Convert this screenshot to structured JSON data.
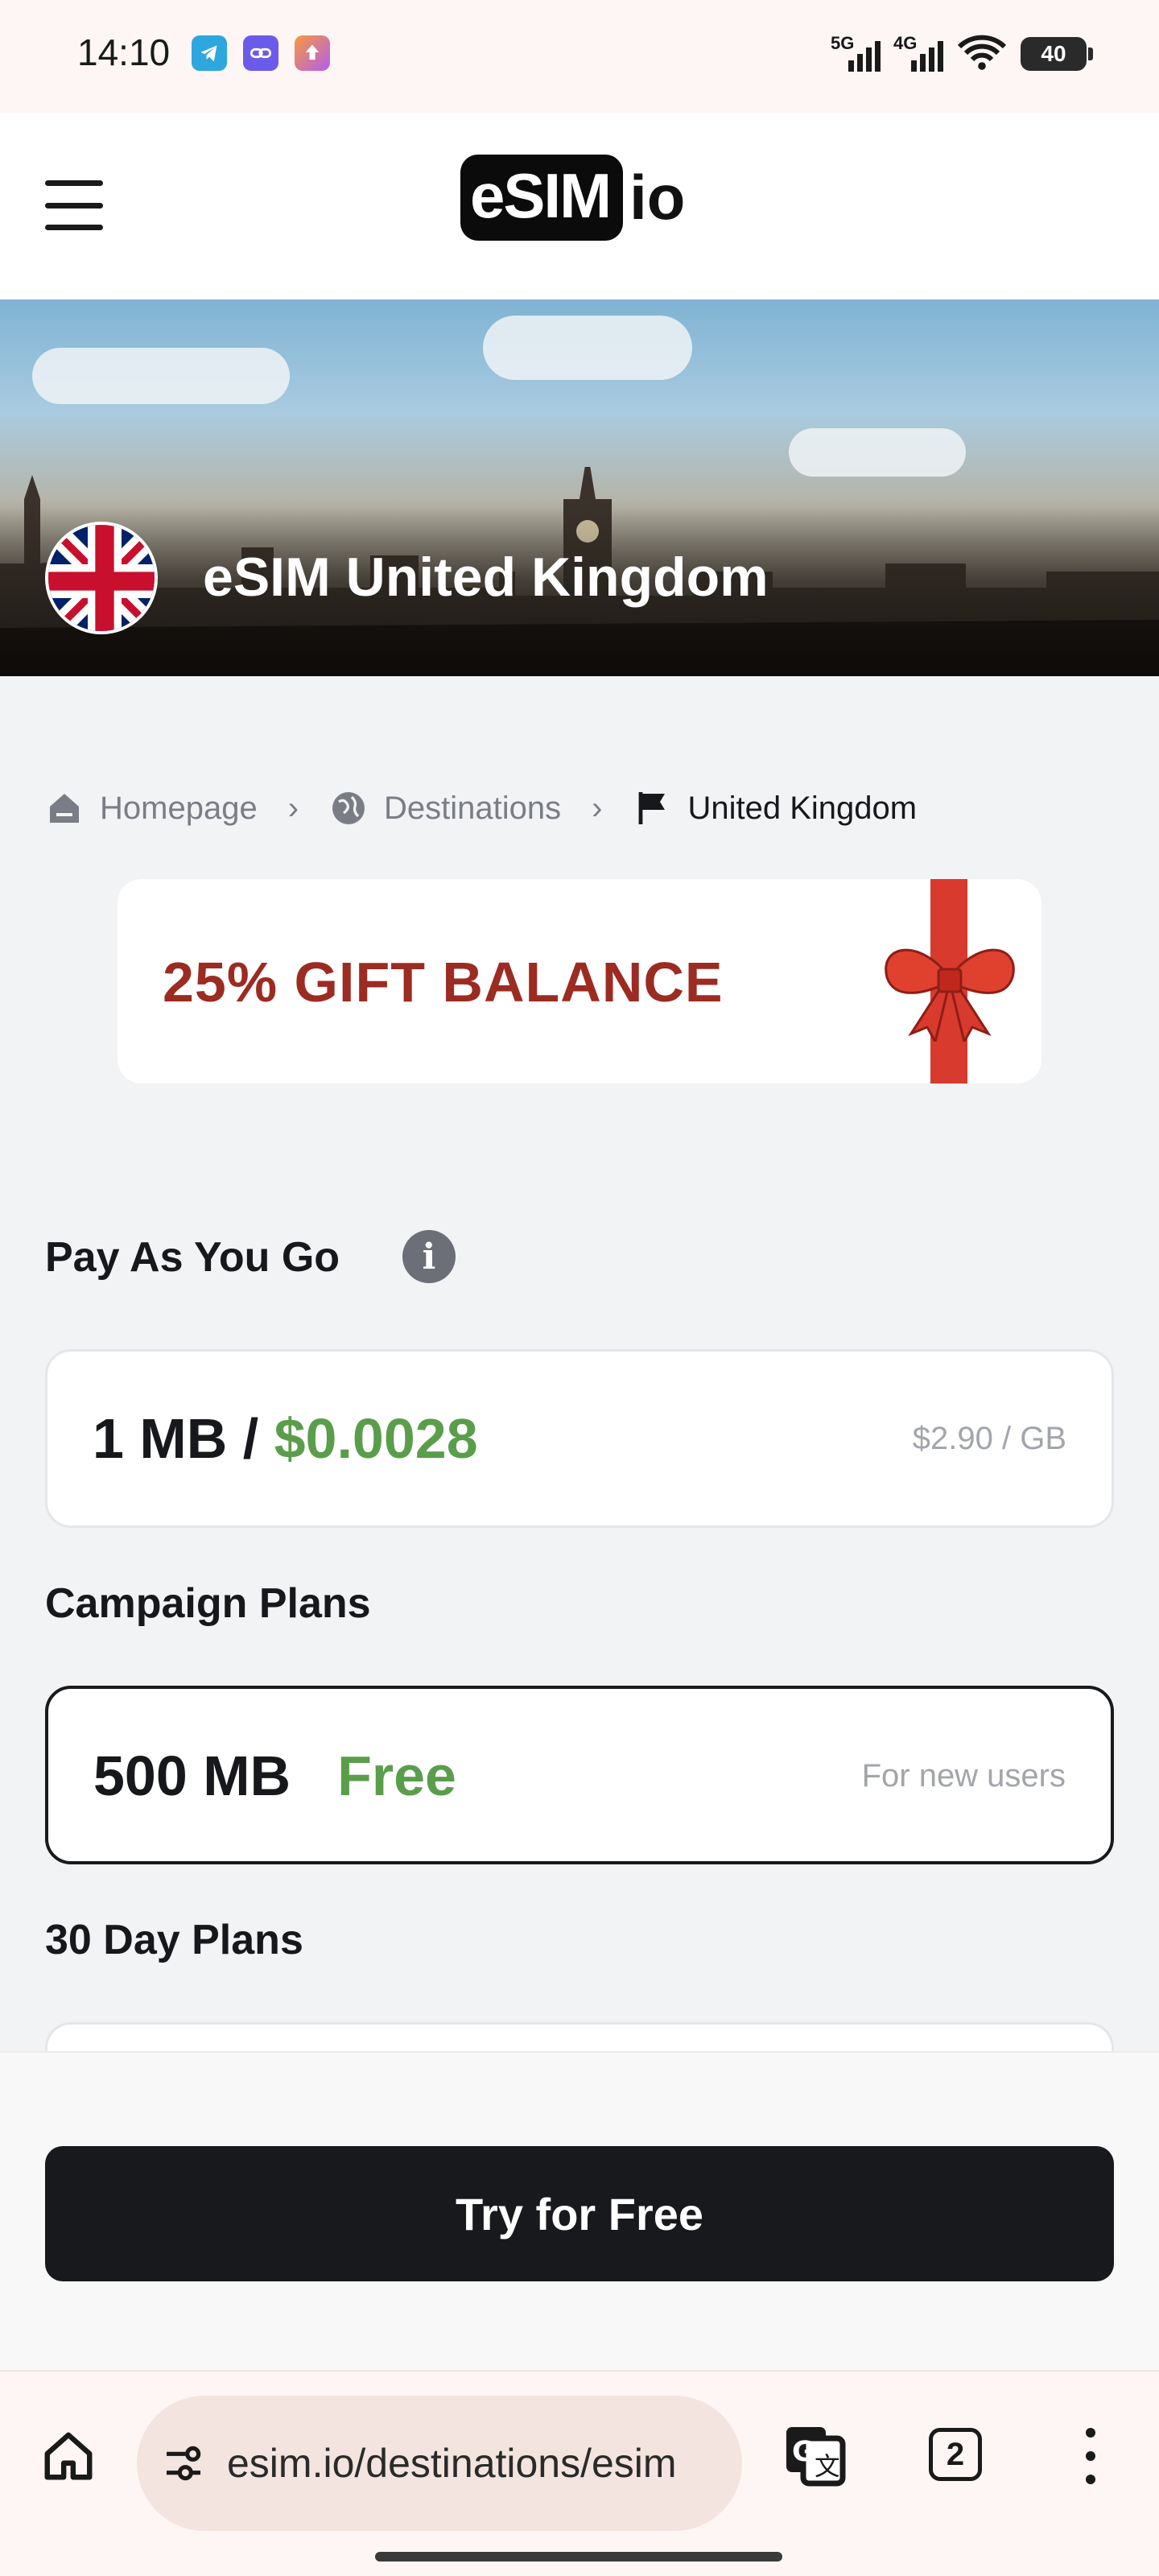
{
  "status_bar": {
    "time": "14:10",
    "apps": [
      "telegram-icon",
      "link-icon",
      "upload-icon"
    ],
    "network_1": "5G",
    "network_2": "4G",
    "battery": "40"
  },
  "header": {
    "logo_box": "eSIM",
    "logo_suffix": "io",
    "menu_icon": "hamburger-icon"
  },
  "hero": {
    "title": "eSIM United Kingdom",
    "flag": "uk-flag"
  },
  "breadcrumb": {
    "items": [
      {
        "label": "Homepage",
        "icon": "home-icon"
      },
      {
        "label": "Destinations",
        "icon": "globe-icon"
      },
      {
        "label": "United Kingdom",
        "icon": "flag-icon"
      }
    ]
  },
  "promo": {
    "text": "25% GIFT BALANCE",
    "ribbon_color": "#d93a2e"
  },
  "pay_as_you_go": {
    "title": "Pay As You Go",
    "amount": "1 MB / ",
    "price": "$0.0028",
    "rate": "$2.90 / GB"
  },
  "campaign": {
    "title": "Campaign Plans",
    "amount": "500 MB",
    "price": "Free",
    "note": "For new users"
  },
  "plans_30": {
    "title": "30 Day Plans"
  },
  "cta": {
    "label": "Try for Free"
  },
  "browser": {
    "url": "esim.io/destinations/esim",
    "tab_count": "2"
  },
  "colors": {
    "accent_green": "#5a9e4b",
    "promo_red": "#9c2b22",
    "cta_bg": "#18191c"
  }
}
